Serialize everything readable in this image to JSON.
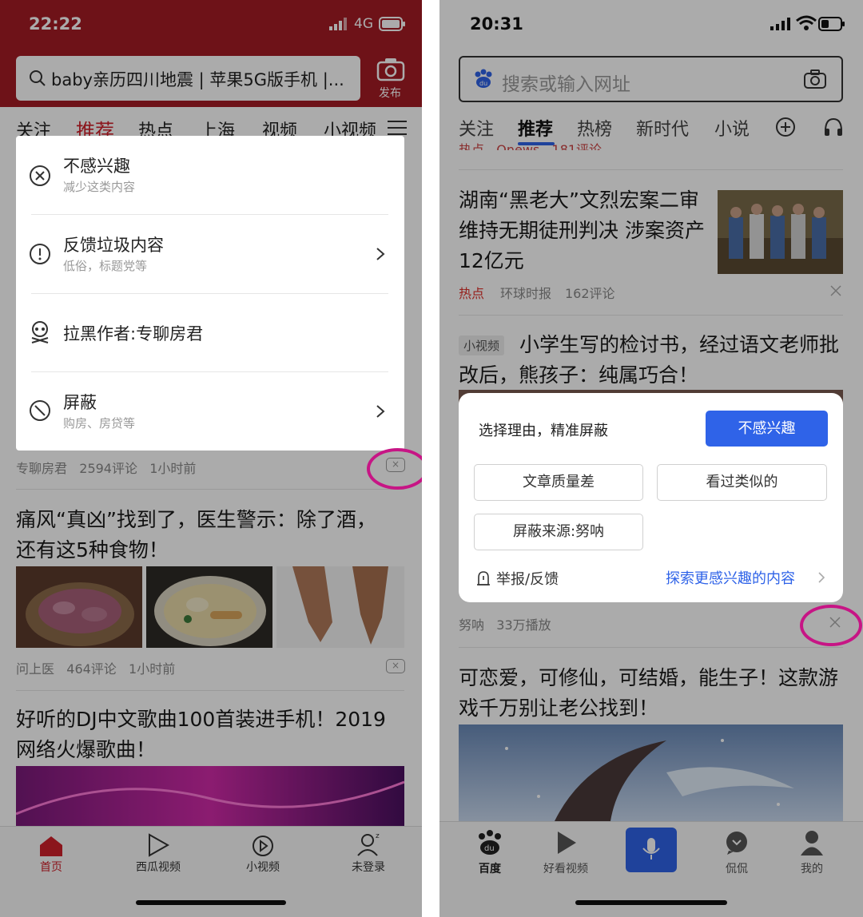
{
  "left": {
    "status": {
      "time": "22:22",
      "network": "4G"
    },
    "search": {
      "text": "baby亲历四川地震 | 苹果5G版手机 |...",
      "publish_label": "发布"
    },
    "tabs": [
      "关注",
      "推荐",
      "热点",
      "上海",
      "视频",
      "小视频"
    ],
    "menu": {
      "items": [
        {
          "title": "不感兴趣",
          "sub": "减少这类内容"
        },
        {
          "title": "反馈垃圾内容",
          "sub": "低俗，标题党等"
        },
        {
          "title": "拉黑作者:专聊房君",
          "sub": ""
        },
        {
          "title": "屏蔽",
          "sub": "购房、房贷等"
        }
      ]
    },
    "article1_meta": "专聊房君   2594评论   1小时前",
    "article2": {
      "title": "痛风“真凶”找到了，医生警示：除了酒，还有这5种食物！",
      "meta": "问上医   464评论   1小时前"
    },
    "article3": {
      "title": "好听的DJ中文歌曲100首装进手机！2019网络火爆歌曲！"
    },
    "bottom_nav": [
      "首页",
      "西瓜视频",
      "小视频",
      "未登录"
    ],
    "colors": {
      "brand_red": "#a51c24",
      "highlight_pink": "#c71585"
    }
  },
  "right": {
    "status": {
      "time": "20:31"
    },
    "search": {
      "placeholder": "搜索或输入网址"
    },
    "tabs": [
      "关注",
      "推荐",
      "热榜",
      "新时代",
      "小说"
    ],
    "peek_meta": "热点   Qnews   181评论",
    "article1": {
      "title": "湖南“黑老大”文烈宏案二审维持无期徒刑判决 涉案资产12亿元",
      "tag": "热点",
      "source": "环球时报",
      "comments": "162评论"
    },
    "article2": {
      "badge": "小视频",
      "title": "小学生写的检讨书，经过语文老师批改后，熊孩子：纯属巧合！",
      "meta": "努呐   33万播放"
    },
    "popup": {
      "heading": "选择理由，精准屏蔽",
      "primary_button": "不感兴趣",
      "chips": [
        "文章质量差",
        "看过类似的",
        "屏蔽来源:努呐"
      ],
      "report": "举报/反馈",
      "explore": "探索更感兴趣的内容"
    },
    "article3": {
      "title": "可恋爱，可修仙，可结婚，能生子！这款游戏千万别让老公找到！"
    },
    "bottom_nav": [
      "百度",
      "好看视频",
      "",
      "侃侃",
      "我的"
    ],
    "colors": {
      "accent_blue": "#2f63e8",
      "tag_red": "#e0302a"
    }
  }
}
